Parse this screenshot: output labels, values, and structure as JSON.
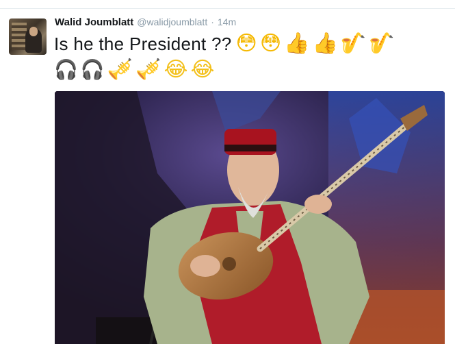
{
  "tweet": {
    "author_name": "Walid Joumblatt",
    "author_handle": "@walidjoumblatt",
    "separator": "·",
    "timestamp": "14m",
    "text": "Is he the President ??",
    "emoji_line1": [
      {
        "name": "flushed-face-icon",
        "glyph": "😳"
      },
      {
        "name": "flushed-face-icon",
        "glyph": "😳"
      },
      {
        "name": "thumbs-up-icon",
        "glyph": "👍"
      },
      {
        "name": "thumbs-up-icon",
        "glyph": "👍"
      },
      {
        "name": "saxophone-icon",
        "glyph": "🎷"
      },
      {
        "name": "saxophone-icon",
        "glyph": "🎷"
      }
    ],
    "emoji_line2": [
      {
        "name": "headphones-icon",
        "glyph": "🎧"
      },
      {
        "name": "headphones-icon",
        "glyph": "🎧"
      },
      {
        "name": "trumpet-icon",
        "glyph": "🎺"
      },
      {
        "name": "trumpet-icon",
        "glyph": "🎺"
      },
      {
        "name": "tears-of-joy-icon",
        "glyph": "😂"
      },
      {
        "name": "tears-of-joy-icon",
        "glyph": "😂"
      }
    ]
  },
  "colors": {
    "name": "#14171a",
    "meta": "#8899a6",
    "vest": "#b01c2a",
    "shirt": "#a9b58e",
    "stage_blue": "#2b3c8f"
  }
}
